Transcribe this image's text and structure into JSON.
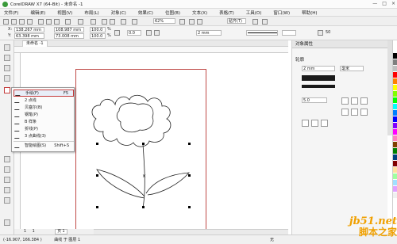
{
  "window": {
    "title": "CorelDRAW X7 (64-Bit) - 未命名 -1",
    "controls": [
      "—",
      "□",
      "×"
    ]
  },
  "menu": [
    "文件(F)",
    "编辑(E)",
    "视图(V)",
    "布局(L)",
    "对象(C)",
    "效果(C)",
    "位图(B)",
    "文本(X)",
    "表格(T)",
    "工具(O)",
    "窗口(W)",
    "帮助(H)"
  ],
  "property_bar": {
    "x": "138.267 mm",
    "y": "63.398 mm",
    "w": "108.987 mm",
    "h": "73.008 mm",
    "scale_w": "100.0",
    "scale_h": "100.0",
    "pct": "%",
    "angle": "0.0",
    "zoom": "62%",
    "outline_width": "2 mm",
    "snap_label": "贴齐(T)",
    "smoothing": "50"
  },
  "doc_tab": "未命名 -1",
  "flyout": {
    "items": [
      {
        "label": "手绘(F)",
        "shortcut": "F5"
      },
      {
        "label": "2 点线",
        "shortcut": ""
      },
      {
        "label": "贝塞尔(B)",
        "shortcut": ""
      },
      {
        "label": "钢笔(P)",
        "shortcut": ""
      },
      {
        "label": "B 样条",
        "shortcut": ""
      },
      {
        "label": "折线(P)",
        "shortcut": ""
      },
      {
        "label": "3 点曲线(3)",
        "shortcut": ""
      },
      {
        "label": "智能绘图(S)",
        "shortcut": "Shift+S"
      }
    ]
  },
  "docker": {
    "title": "对象属性",
    "section": "轮廓",
    "width_value": "2 mm",
    "unit": "毫米",
    "miter": "5.0"
  },
  "pager": {
    "current": "1",
    "of": "1",
    "page_tab": "页 1"
  },
  "status": {
    "coords": "(-16.907, 166.384 )",
    "text": "曲线 于 图层 1",
    "fill_none": "无"
  },
  "watermark": {
    "line1": "jb51.net",
    "line2": "脚本之家"
  },
  "palette_colors": [
    "#ffffff",
    "#000000",
    "#7f7f7f",
    "#c0c0c0",
    "#ff0000",
    "#ff8000",
    "#ffff00",
    "#80ff00",
    "#00ff00",
    "#00ffff",
    "#0080ff",
    "#0000ff",
    "#8000ff",
    "#ff00ff",
    "#ff80c0",
    "#804000",
    "#008000",
    "#004080",
    "#800000",
    "#ffe0a0",
    "#a0ffa0",
    "#a0e0ff",
    "#e0a0ff",
    "#f0f0f0"
  ]
}
